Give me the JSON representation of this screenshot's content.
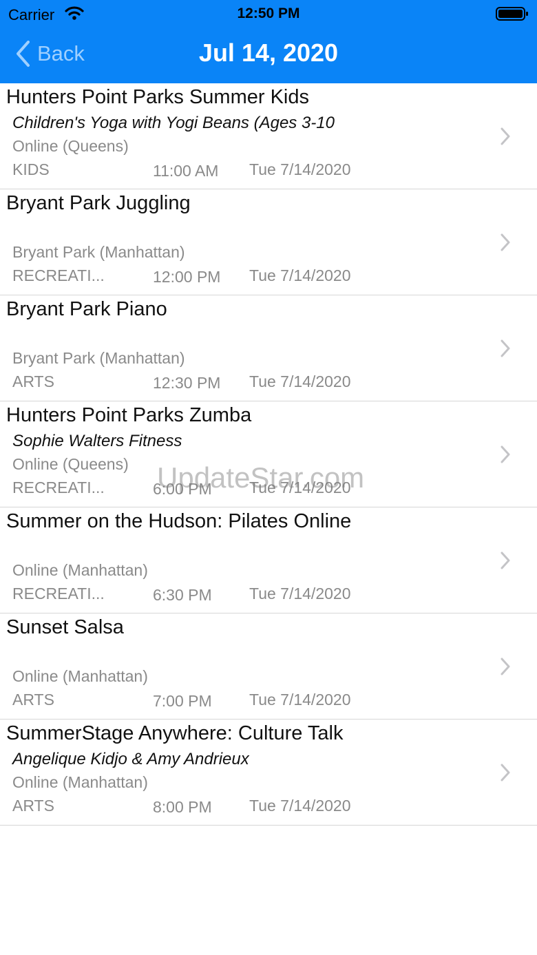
{
  "status_bar": {
    "carrier": "Carrier",
    "time": "12:50 PM"
  },
  "nav": {
    "back_label": "Back",
    "title": "Jul 14, 2020"
  },
  "events": [
    {
      "title": "Hunters Point Parks Summer Kids",
      "subtitle": "Children's Yoga with Yogi Beans (Ages 3-10",
      "location": "Online (Queens)",
      "category": "KIDS",
      "time": "11:00 AM",
      "date": "Tue 7/14/2020"
    },
    {
      "title": "Bryant Park Juggling",
      "subtitle": "",
      "location": "Bryant Park (Manhattan)",
      "category": "RECREATI...",
      "time": "12:00 PM",
      "date": "Tue 7/14/2020"
    },
    {
      "title": "Bryant Park Piano",
      "subtitle": "",
      "location": "Bryant Park (Manhattan)",
      "category": "ARTS",
      "time": "12:30 PM",
      "date": "Tue 7/14/2020"
    },
    {
      "title": "Hunters Point Parks Zumba",
      "subtitle": "Sophie Walters Fitness",
      "location": "Online (Queens)",
      "category": "RECREATI...",
      "time": "6:00 PM",
      "date": "Tue 7/14/2020"
    },
    {
      "title": "Summer on the Hudson: Pilates Online",
      "subtitle": "",
      "location": "Online (Manhattan)",
      "category": "RECREATI...",
      "time": "6:30 PM",
      "date": "Tue 7/14/2020"
    },
    {
      "title": "Sunset Salsa",
      "subtitle": "",
      "location": "Online (Manhattan)",
      "category": "ARTS",
      "time": "7:00 PM",
      "date": "Tue 7/14/2020"
    },
    {
      "title": "SummerStage Anywhere: Culture Talk",
      "subtitle": "Angelique Kidjo & Amy Andrieux",
      "location": "Online (Manhattan)",
      "category": "ARTS",
      "time": "8:00 PM",
      "date": "Tue 7/14/2020"
    }
  ],
  "watermark": "UpdateStar.com",
  "colors": {
    "nav_bar": "#0a84f7",
    "back_tint": "#9fd0ff",
    "secondary_text": "#8a8a8a"
  }
}
